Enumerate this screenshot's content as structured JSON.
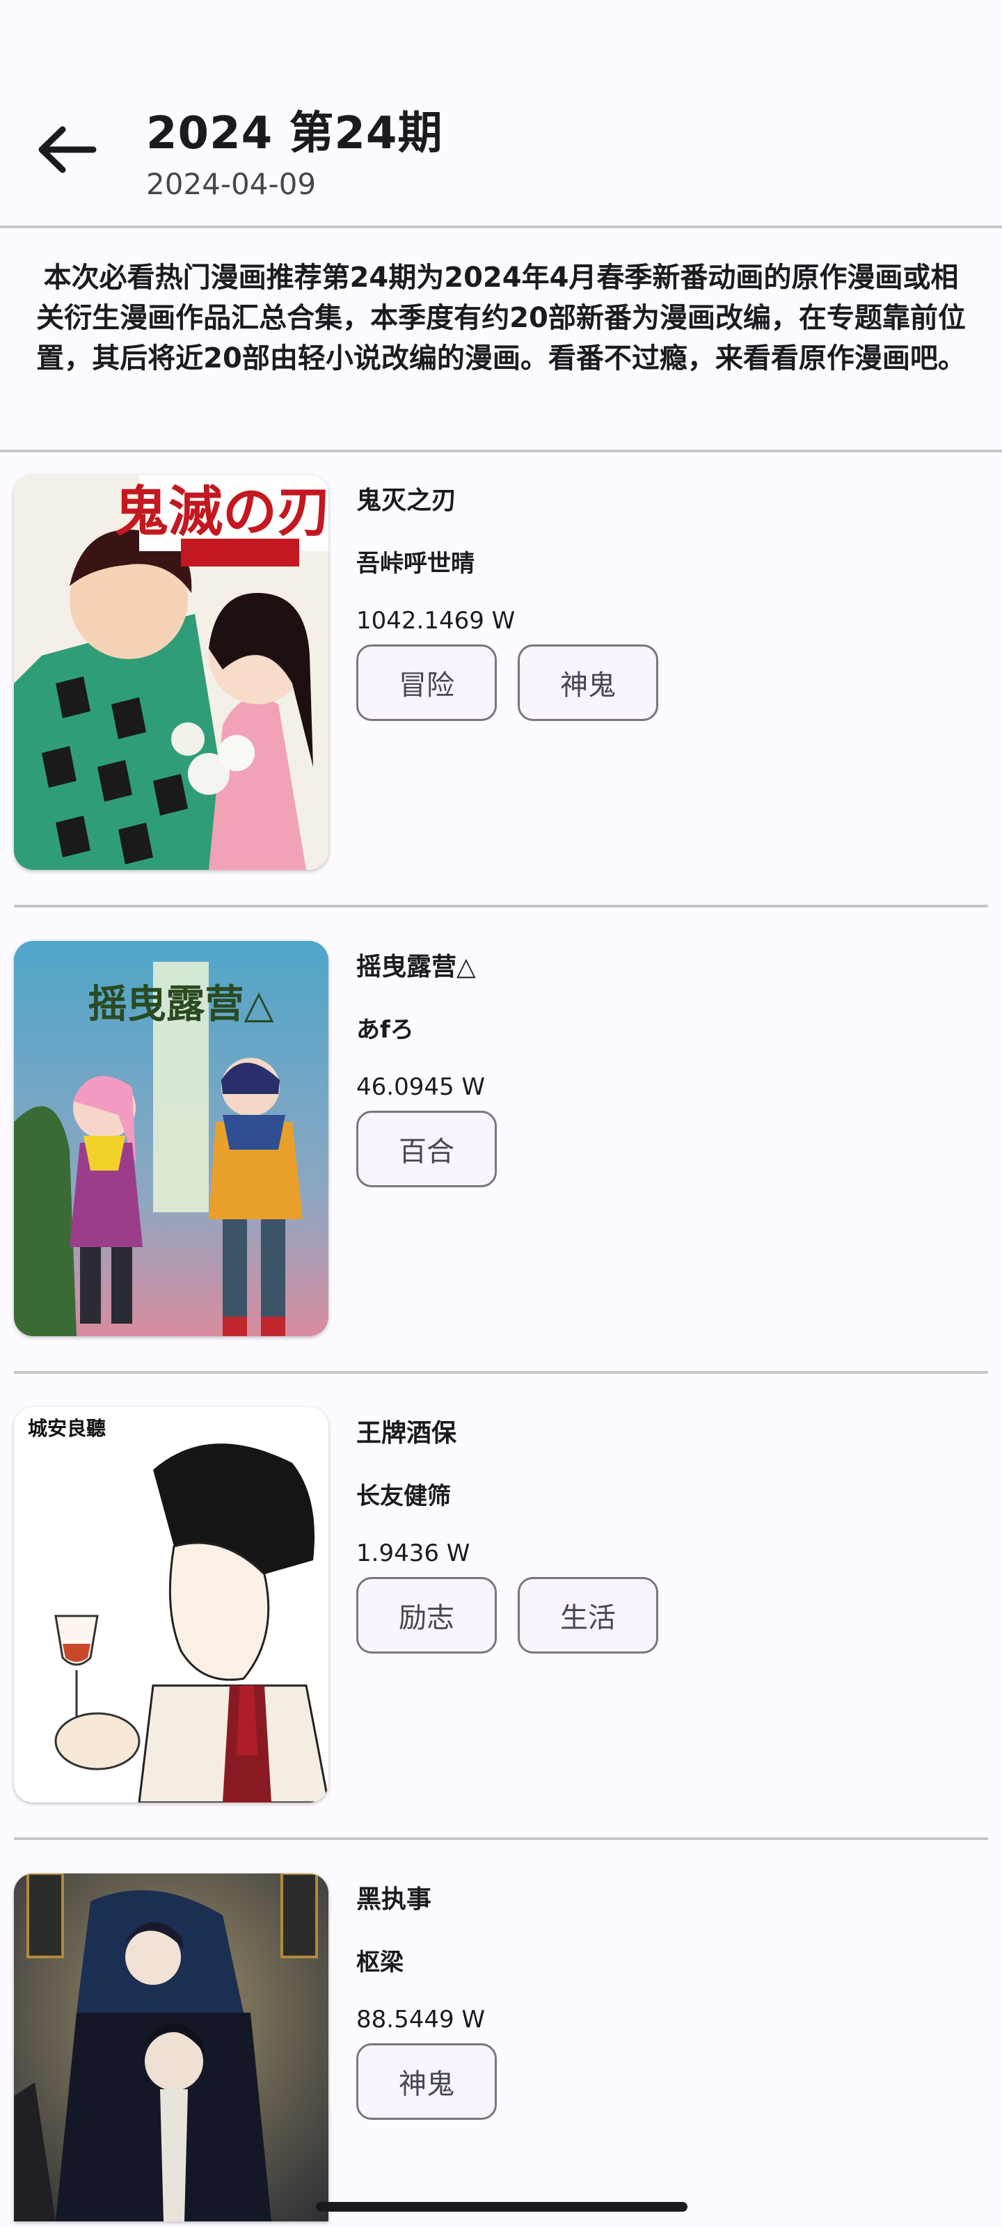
{
  "header": {
    "title": "2024 第24期",
    "date": "2024-04-09"
  },
  "description": "本次必看热门漫画推荐第24期为2024年4月春季新番动画的原作漫画或相关衍生漫画作品汇总合集，本季度有约20部新番为漫画改编，在专题靠前位置，其后将近20部由轻小说改编的漫画。看番不过瘾，来看看原作漫画吧。",
  "items": [
    {
      "title": "鬼灭之刃",
      "author": "吾峠呼世晴",
      "views": "1042.1469 W",
      "tags": [
        "冒险",
        "神鬼"
      ],
      "cover_text": "鬼滅の刃"
    },
    {
      "title": "摇曳露营△",
      "author": "あfろ",
      "views": "46.0945 W",
      "tags": [
        "百合"
      ],
      "cover_text": "摇曳露营△"
    },
    {
      "title": "王牌酒保",
      "author": "长友健筛",
      "views": "1.9436 W",
      "tags": [
        "励志",
        "生活"
      ],
      "cover_text": "城安良聽"
    },
    {
      "title": "黑执事",
      "author": "枢梁",
      "views": "88.5449 W",
      "tags": [
        "神鬼"
      ],
      "cover_text": ""
    }
  ],
  "icons": {
    "back": "arrow-left-icon"
  },
  "colors": {
    "background": "#fdfbff",
    "tag_background": "#fbf4ff",
    "tag_border": "#787680",
    "divider": "#c8c5d0"
  }
}
